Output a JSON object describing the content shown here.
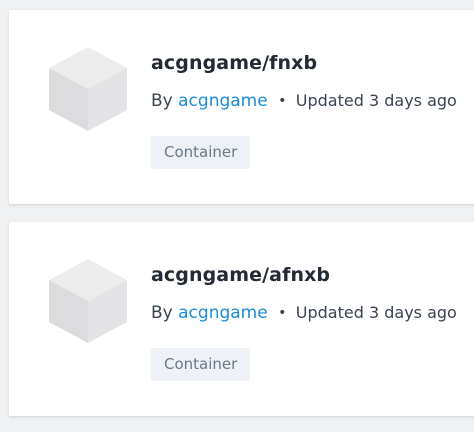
{
  "repositories": [
    {
      "name": "acgngame/fnxb",
      "by_label": "By",
      "author": "acgngame",
      "separator": "•",
      "updated": "Updated 3 days ago",
      "badge": "Container",
      "icon": "container-cube-icon"
    },
    {
      "name": "acgngame/afnxb",
      "by_label": "By",
      "author": "acgngame",
      "separator": "•",
      "updated": "Updated 3 days ago",
      "badge": "Container",
      "icon": "container-cube-icon"
    }
  ],
  "colors": {
    "background": "#f0f1f3",
    "card": "#ffffff",
    "title": "#242a33",
    "link": "#1a8cd8",
    "badge_bg": "#eef1f5",
    "badge_text": "#6b7886",
    "cube_top": "#ececed",
    "cube_left": "#dcdcde",
    "cube_right": "#e4e4e6"
  }
}
